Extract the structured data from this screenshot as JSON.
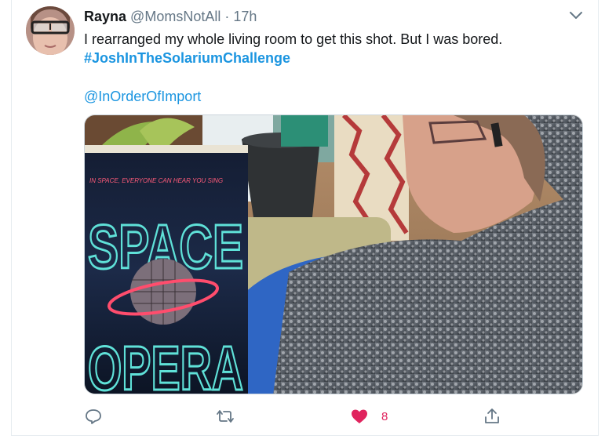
{
  "tweet": {
    "display_name": "Rayna",
    "handle": "@MomsNotAll",
    "separator": "·",
    "time": "17h",
    "text": "I rearranged my whole living room to get this shot. But I was bored.",
    "hashtag": "#JoshInTheSolariumChallenge",
    "mention": "@InOrderOfImport"
  },
  "media": {
    "book_tagline": "IN SPACE, EVERYONE CAN HEAR YOU SING",
    "book_title_line1": "SPACE",
    "book_title_line2": "OPERA"
  },
  "actions": {
    "reply_icon": "reply-icon",
    "retweet_icon": "retweet-icon",
    "like_icon": "heart-icon",
    "like_count": "8",
    "share_icon": "share-icon"
  },
  "colors": {
    "link": "#1b95e0",
    "muted": "#657786",
    "like": "#e0245e",
    "border": "#e6ecf0"
  }
}
